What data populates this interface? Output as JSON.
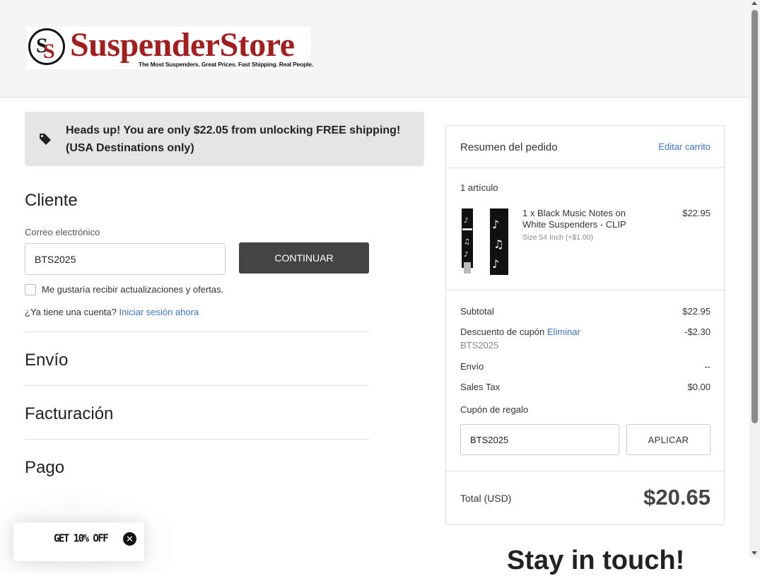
{
  "header": {
    "logo_name": "SuspenderStore",
    "logo_tagline": "The Most Suspenders. Great Prices. Fast Shipping. Real People.",
    "logo_monogram": "SS",
    "brand_color": "#a31f1f"
  },
  "banner": {
    "icon": "tag-icon",
    "text": "Heads up! You are only $22.05 from unlocking FREE shipping! (USA Destinations only)"
  },
  "customer": {
    "title": "Cliente",
    "email_label": "Correo electrónico",
    "email_value": "BTS2025",
    "continue_label": "CONTINUAR",
    "newsletter_label": "Me gustaría recibir actualizaciones y ofertas.",
    "newsletter_checked": false,
    "account_question": "¿Ya tiene una cuenta?",
    "login_link": "Iniciar sesión ahora"
  },
  "sections": {
    "shipping": "Envío",
    "billing": "Facturación",
    "payment": "Pago"
  },
  "summary": {
    "title": "Resumen del pedido",
    "edit_cart": "Editar carrito",
    "item_count": "1 artículo",
    "item": {
      "name": "1 x Black Music Notes on White Suspenders - CLIP",
      "size": "Size 54 Inch (+$1.00)",
      "price": "$22.95"
    },
    "subtotal_label": "Subtotal",
    "subtotal_value": "$22.95",
    "discount_label": "Descuento de cupón",
    "discount_remove": "Eliminar",
    "discount_code": "BTS2025",
    "discount_value": "-$2.30",
    "shipping_label": "Envío",
    "shipping_value": "--",
    "tax_label": "Sales Tax",
    "tax_value": "$0.00",
    "gift_label": "Cupón de regalo",
    "gift_value": "BTS2025",
    "apply_label": "APLICAR",
    "total_label": "Total (USD)",
    "total_value": "$20.65"
  },
  "partial_heading": "Stay in touch!",
  "promo": {
    "text": "GET 10% OFF",
    "close_icon": "close-icon"
  },
  "colors": {
    "link": "#3b74c9",
    "button_dark": "#444444",
    "banner_bg": "#e5e5e5"
  }
}
